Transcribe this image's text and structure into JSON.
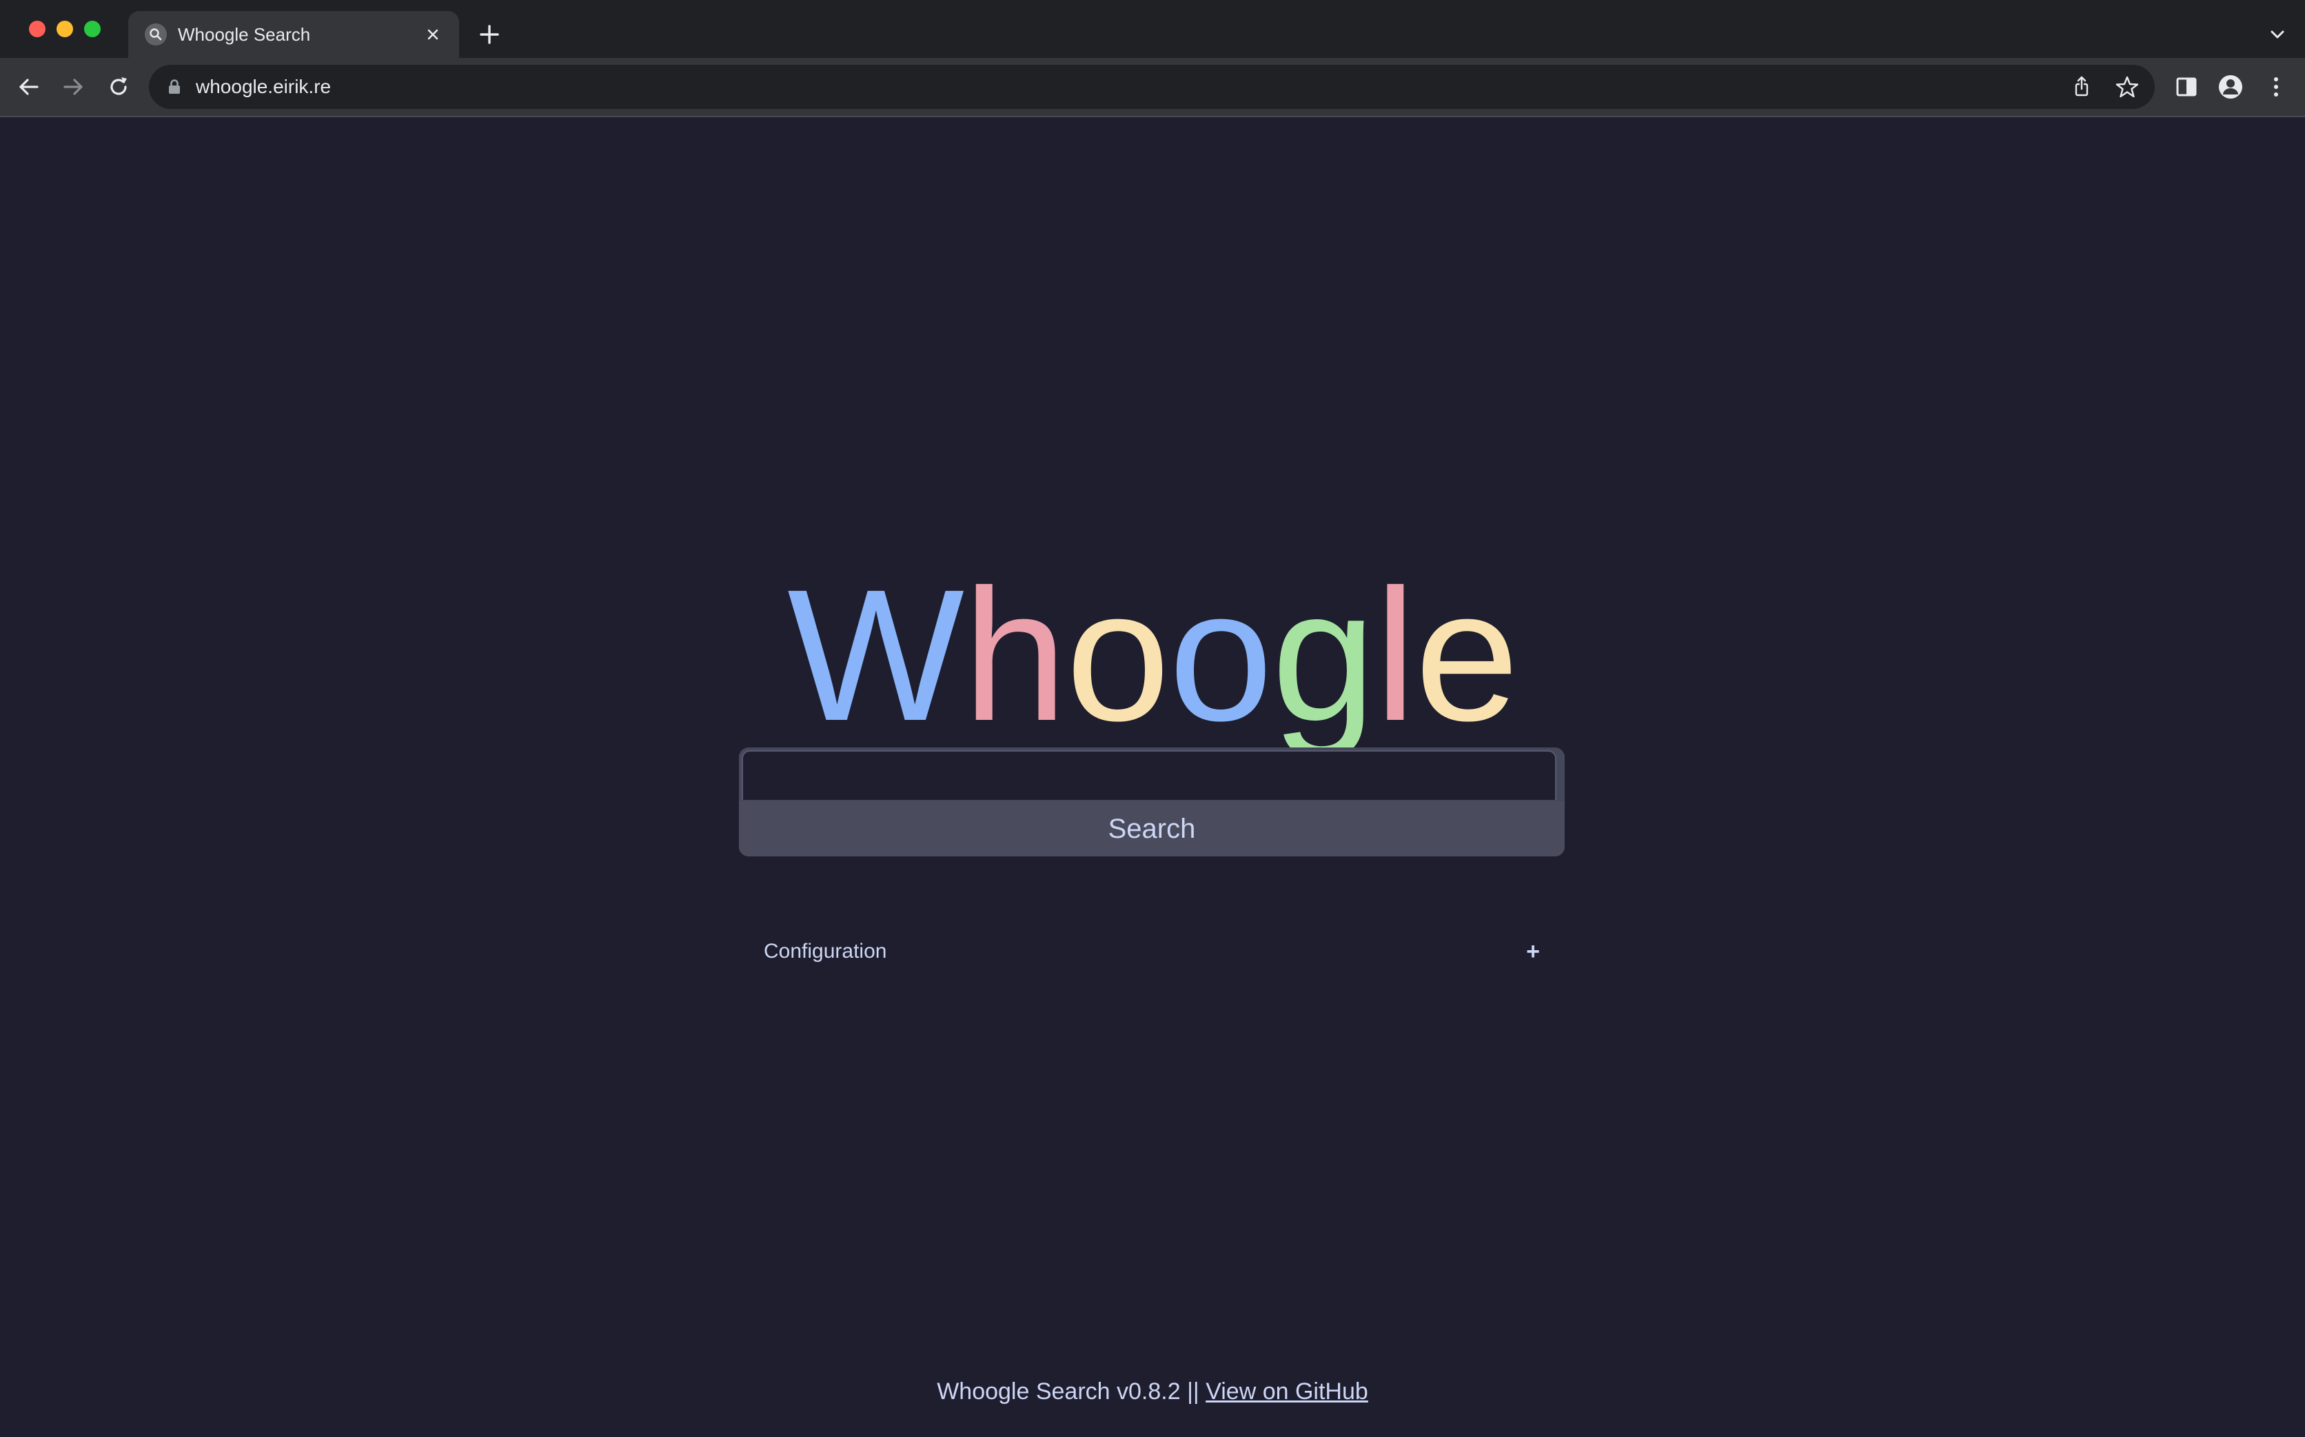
{
  "browser": {
    "tab": {
      "title": "Whoogle Search",
      "favicon": "search-icon"
    },
    "address_bar": {
      "url": "whoogle.eirik.re",
      "secure_icon": "lock-icon"
    },
    "toolbar_icons": [
      "back-icon",
      "forward-icon",
      "reload-icon",
      "share-icon",
      "star-icon",
      "side-panel-icon",
      "profile-icon",
      "menu-icon"
    ]
  },
  "logo": {
    "letters": [
      {
        "char": "W",
        "color": "#89b4fa"
      },
      {
        "char": "h",
        "color": "#eba0ac"
      },
      {
        "char": "o",
        "color": "#f9e2af"
      },
      {
        "char": "o",
        "color": "#89b4fa"
      },
      {
        "char": "g",
        "color": "#a6e3a1"
      },
      {
        "char": "l",
        "color": "#eba0ac"
      },
      {
        "char": "e",
        "color": "#f9e2af"
      }
    ]
  },
  "search": {
    "value": "",
    "button_label": "Search"
  },
  "config": {
    "label": "Configuration",
    "toggle": "+"
  },
  "footer": {
    "text": "Whoogle Search v0.8.2 ||",
    "link_label": "View on GitHub"
  },
  "colors": {
    "page_bg": "#1e1e2e",
    "text": "#cdd6f4",
    "search_button_bg": "#4a4c5e"
  }
}
